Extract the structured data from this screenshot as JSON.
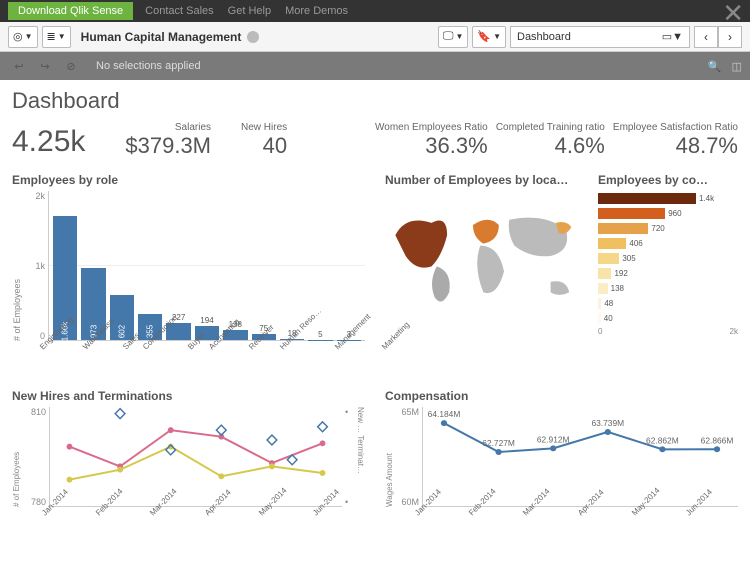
{
  "topbar": {
    "download": "Download Qlik Sense",
    "links": [
      "Contact Sales",
      "Get Help",
      "More Demos"
    ]
  },
  "toolbar": {
    "app_title": "Human Capital Management",
    "sheet_label": "Dashboard"
  },
  "selections": {
    "text": "No selections applied"
  },
  "page_title": "Dashboard",
  "kpis_left": {
    "headcount": "4.25k",
    "salaries_label": "Salaries",
    "salaries": "$379.3M",
    "new_hires_label": "New Hires",
    "new_hires": "40"
  },
  "kpis_right": {
    "women_label": "Women Employees Ratio",
    "women": "36.3%",
    "training_label": "Completed Training ratio",
    "training": "4.6%",
    "satisfaction_label": "Employee Satisfaction Ratio",
    "satisfaction": "48.7%"
  },
  "titles": {
    "employees_by_role": "Employees by role",
    "employees_by_loc": "Number of Employees by loca…",
    "employees_by_co": "Employees by co…",
    "hires_terms": "New Hires and Terminations",
    "compensation": "Compensation"
  },
  "axes": {
    "role_y": "# of Employees",
    "role_ticks": [
      "2k",
      "1k",
      "0"
    ],
    "hires_y": "# of Employees",
    "hires_y2": "New … Terminat…",
    "hires_ticks": [
      "810",
      "780"
    ],
    "comp_y": "Wages Amount",
    "comp_ticks": [
      "65M",
      "60M"
    ],
    "country_ticks": [
      "0",
      "2k"
    ]
  },
  "chart_data": {
    "employees_by_role": {
      "type": "bar",
      "ylabel": "# of Employees",
      "ylim": [
        0,
        2000
      ],
      "categories": [
        "Engineering",
        "Warehouse",
        "Sales",
        "Construction",
        "Buyer",
        "Accounting",
        "Receiver",
        "Human Reso…",
        "Management",
        "",
        "Marketing"
      ],
      "values": [
        1660,
        973,
        602,
        355,
        227,
        194,
        138,
        75,
        18,
        5,
        3
      ],
      "value_labels": [
        "1.66k",
        "973",
        "602",
        "355",
        "227",
        "194",
        "138",
        "75",
        "18",
        "5",
        "3"
      ]
    },
    "employees_by_country": {
      "type": "bar",
      "orientation": "horizontal",
      "xlim": [
        0,
        2000
      ],
      "values": [
        1400,
        960,
        720,
        406,
        305,
        192,
        138,
        48,
        40
      ],
      "value_labels": [
        "1.4k",
        "960",
        "720",
        "406",
        "305",
        "192",
        "138",
        "48",
        "40"
      ],
      "colors": [
        "#6b2a0e",
        "#d35f1e",
        "#e6a24a",
        "#f0c060",
        "#f5d788",
        "#f8e3a8",
        "#fbecc5",
        "#fdf3db",
        "#fef9ee"
      ]
    },
    "new_hires_terminations": {
      "type": "line",
      "x": [
        "Jan-2014",
        "Feb-2014",
        "Mar-2014",
        "Apr-2014",
        "May-2014",
        "Jun-2014"
      ],
      "ylim": [
        780,
        810
      ],
      "series": [
        {
          "name": "New Hires",
          "color": "#d96b8a",
          "values": [
            798,
            792,
            803,
            801,
            793,
            799
          ]
        },
        {
          "name": "Terminations",
          "color": "#d6c84a",
          "values": [
            788,
            791,
            798,
            789,
            792,
            790
          ]
        }
      ],
      "markers_diamond": [
        [
          1,
          808
        ],
        [
          2,
          797
        ],
        [
          3,
          803
        ],
        [
          4,
          800
        ],
        [
          4.4,
          794
        ],
        [
          5,
          804
        ]
      ]
    },
    "compensation": {
      "type": "line",
      "x": [
        "Jan-2014",
        "Feb-2014",
        "Mar-2014",
        "Apr-2014",
        "May-2014",
        "Jun-2014"
      ],
      "ylim": [
        60,
        65
      ],
      "values": [
        64.184,
        62.727,
        62.912,
        63.739,
        62.862,
        62.866
      ],
      "value_labels": [
        "64.184M",
        "62.727M",
        "62.912M",
        "63.739M",
        "62.862M",
        "62.866M"
      ],
      "color": "#4477aa"
    }
  }
}
